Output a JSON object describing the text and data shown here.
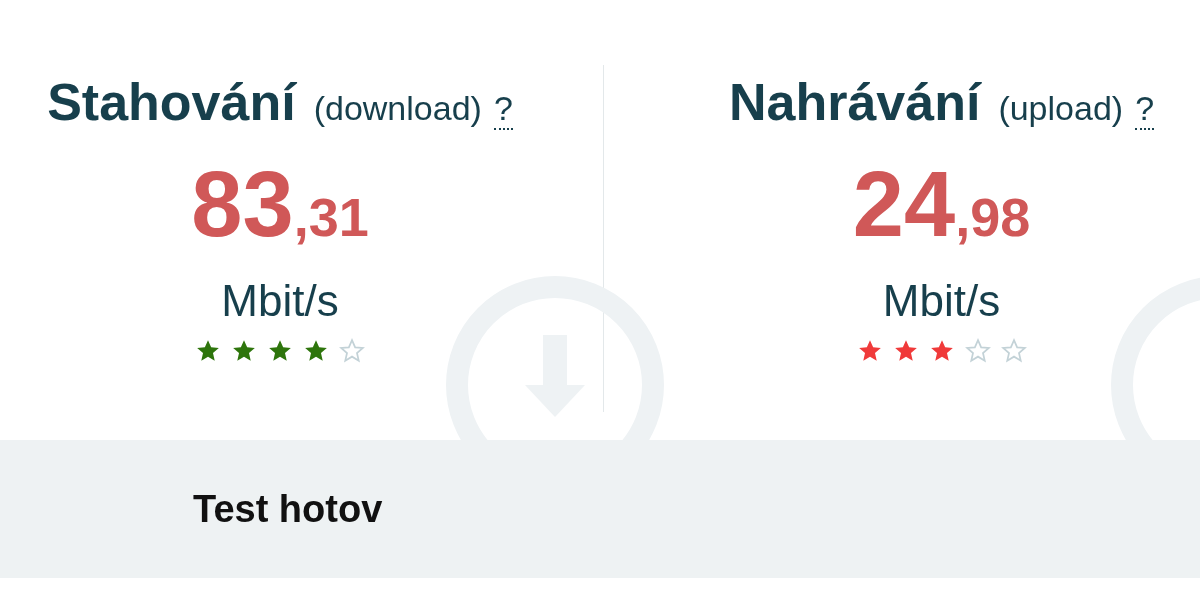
{
  "panels": [
    {
      "title": "Stahování",
      "subtitle": "(download)",
      "help": "?",
      "value_whole": "83",
      "value_decimal": ",31",
      "unit": "Mbit/s",
      "stars": 4,
      "color": "#2e750c"
    },
    {
      "title": "Nahrávání",
      "subtitle": "(upload)",
      "help": "?",
      "value_whole": "24",
      "value_decimal": ",98",
      "unit": "Mbit/s",
      "stars": 3,
      "color": "#f03a3a"
    }
  ],
  "status": {
    "text": "Test hotov"
  }
}
